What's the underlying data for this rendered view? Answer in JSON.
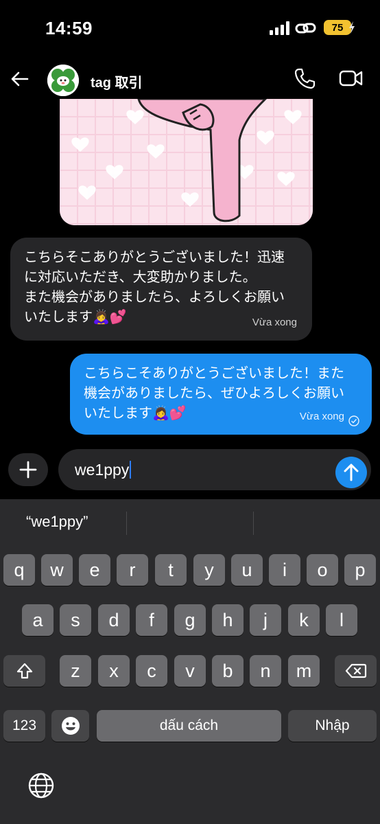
{
  "status_bar": {
    "time": "14:59",
    "battery": "75"
  },
  "chat": {
    "contact_name": "tag 取引",
    "messages": [
      {
        "direction": "in",
        "text": "こちらそこありがとうございました！迅速\nに対応いただき、大変助かりました。\nまた機会がありましたら、よろしくお願い\nいたします🙇‍♀️💕",
        "time": "Vừa xong"
      },
      {
        "direction": "out",
        "text": "こちらこそありがとうございました！また\n機会がありましたら、ぜひよろしくお願い\nいたします🙇‍♀️💕",
        "time": "Vừa xong"
      }
    ]
  },
  "compose": {
    "value": "we1ppy"
  },
  "keyboard": {
    "suggestion": "“we1ppy”",
    "row1": [
      "q",
      "w",
      "e",
      "r",
      "t",
      "y",
      "u",
      "i",
      "o",
      "p"
    ],
    "row2": [
      "a",
      "s",
      "d",
      "f",
      "g",
      "h",
      "j",
      "k",
      "l"
    ],
    "row3": [
      "z",
      "x",
      "c",
      "v",
      "b",
      "n",
      "m"
    ],
    "numbers_key": "123",
    "space_key": "dấu cách",
    "return_key": "Nhập"
  },
  "icons": {
    "back": "back-arrow-icon",
    "phone": "phone-icon",
    "video": "video-camera-icon",
    "add": "plus-icon",
    "send": "send-arrow-icon",
    "shift": "shift-icon",
    "delete": "backspace-icon",
    "emoji": "emoji-icon",
    "globe": "globe-icon"
  },
  "colors": {
    "outgoing_bubble": "#1d8ef0",
    "incoming_bubble": "#262628",
    "battery": "#f2c230",
    "keyboard_bg": "#2b2b2d"
  }
}
